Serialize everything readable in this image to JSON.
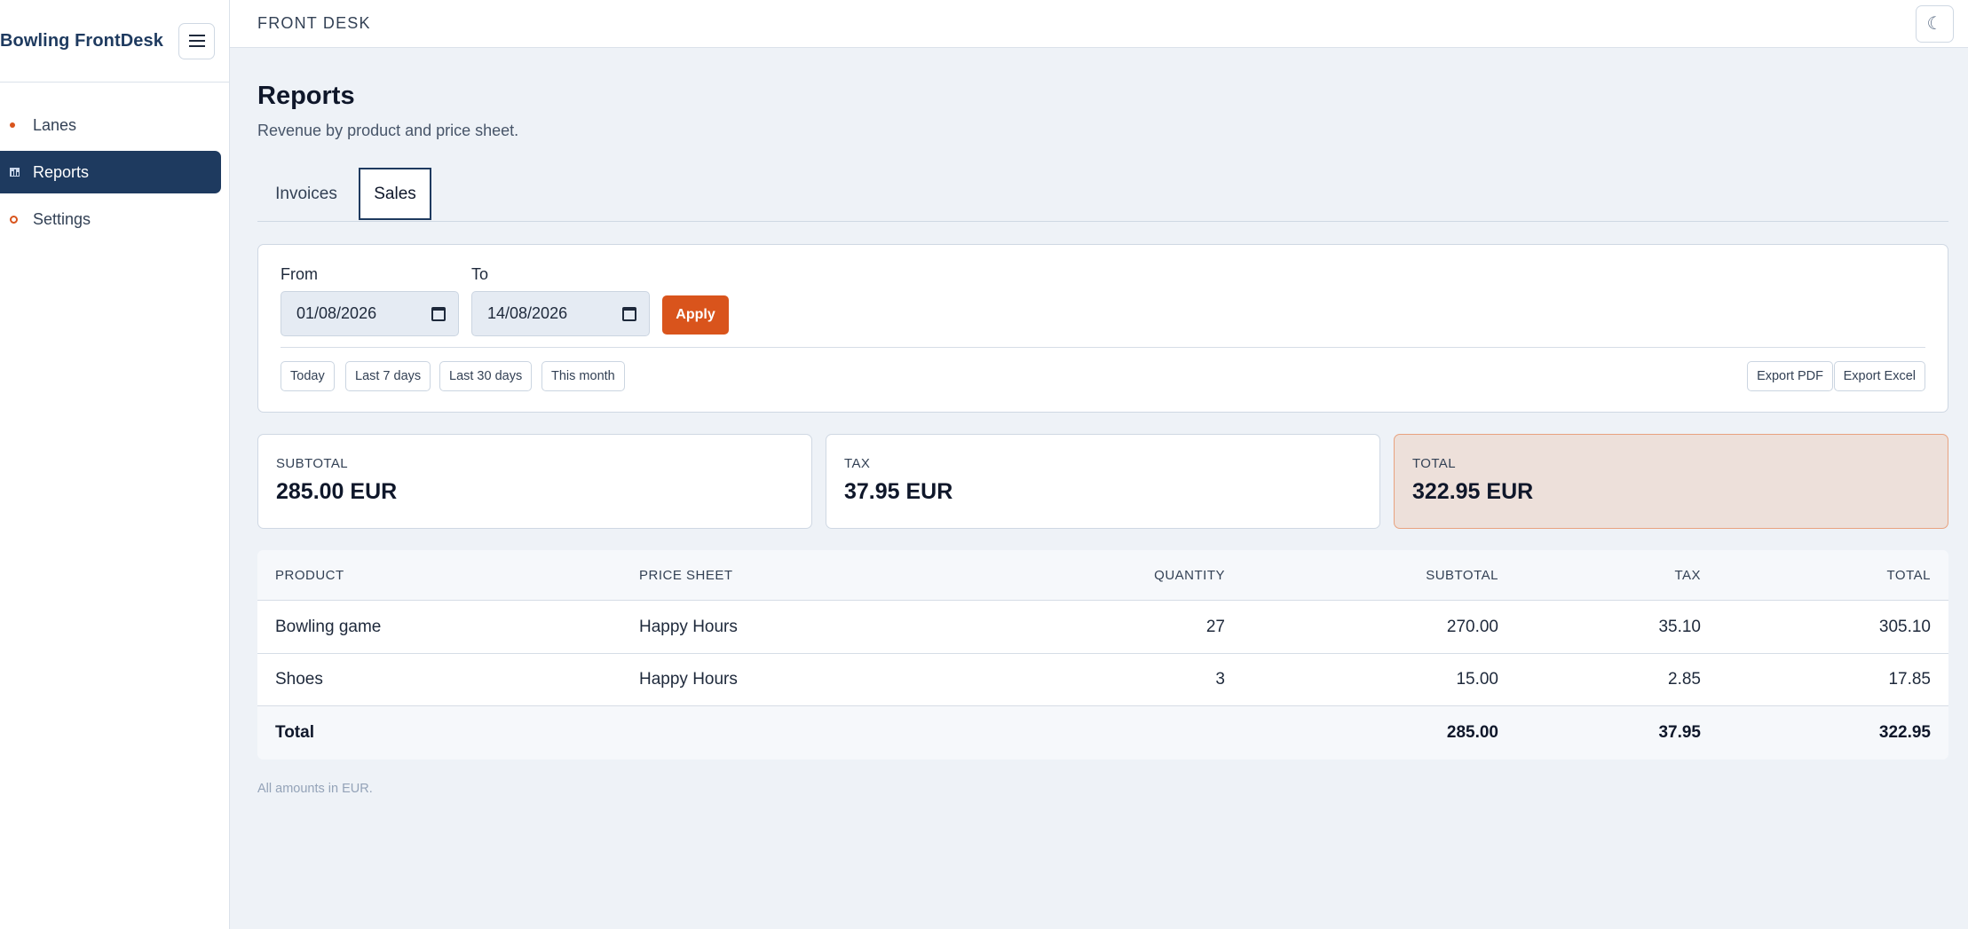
{
  "app": {
    "brand": "Bowling FrontDesk",
    "topbar_title": "FRONT DESK",
    "theme_toggle_glyph": "☾"
  },
  "sidebar": {
    "items": [
      {
        "label": "Lanes",
        "icon": "dot-icon",
        "active": false
      },
      {
        "label": "Reports",
        "icon": "bar-chart-icon",
        "active": true
      },
      {
        "label": "Settings",
        "icon": "gear-icon",
        "active": false
      }
    ]
  },
  "page": {
    "title": "Reports",
    "subtitle": "Revenue by product and price sheet."
  },
  "tabs": [
    {
      "label": "Invoices",
      "active": false
    },
    {
      "label": "Sales",
      "active": true
    }
  ],
  "filters": {
    "from_label": "From",
    "from_value": "01/08/2026",
    "to_label": "To",
    "to_value": "14/08/2026",
    "apply_label": "Apply",
    "presets": [
      "Today",
      "Last 7 days",
      "Last 30 days",
      "This month"
    ],
    "export_pdf": "Export PDF",
    "export_excel": "Export Excel"
  },
  "summary": {
    "subtotal": {
      "label": "SUBTOTAL",
      "value": "285.00 EUR"
    },
    "tax": {
      "label": "TAX",
      "value": "37.95 EUR"
    },
    "total": {
      "label": "TOTAL",
      "value": "322.95 EUR"
    }
  },
  "table": {
    "headers": {
      "product": "PRODUCT",
      "price_sheet": "PRICE SHEET",
      "quantity": "QUANTITY",
      "subtotal": "SUBTOTAL",
      "tax": "TAX",
      "total": "TOTAL"
    },
    "rows": [
      {
        "product": "Bowling game",
        "price_sheet": "Happy Hours",
        "quantity": "27",
        "subtotal": "270.00",
        "tax": "35.10",
        "total": "305.10"
      },
      {
        "product": "Shoes",
        "price_sheet": "Happy Hours",
        "quantity": "3",
        "subtotal": "15.00",
        "tax": "2.85",
        "total": "17.85"
      }
    ],
    "totals": {
      "label": "Total",
      "subtotal": "285.00",
      "tax": "37.95",
      "total": "322.95"
    }
  },
  "footnote": "All amounts in EUR.",
  "colors": {
    "accent": "#d9541c",
    "navy": "#1e3a5f",
    "total_card_bg": "#ede0da"
  }
}
